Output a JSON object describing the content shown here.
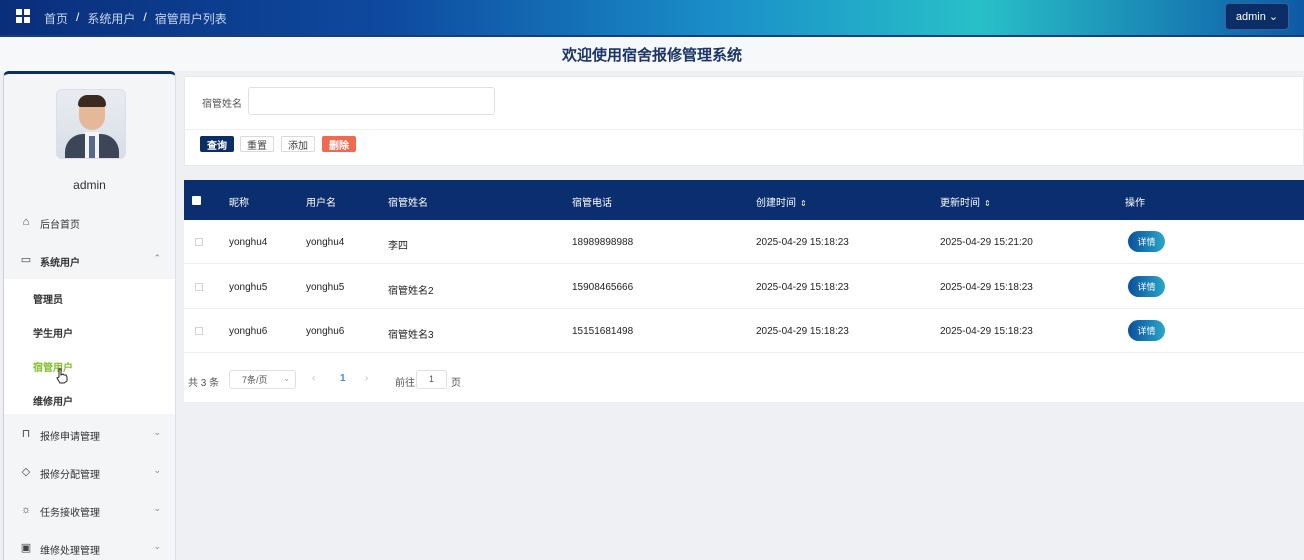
{
  "header": {
    "breadcrumb": [
      "首页",
      "系统用户",
      "宿管用户列表"
    ],
    "admin_label": "admin"
  },
  "page_title": "欢迎使用宿舍报修管理系统",
  "sidebar": {
    "username": "admin",
    "items": [
      {
        "label": "后台首页",
        "icon": "home-icon"
      },
      {
        "label": "系统用户",
        "icon": "monitor-icon"
      },
      {
        "label": "报修申请管理",
        "icon": "bookmark-icon"
      },
      {
        "label": "报修分配管理",
        "icon": "tag-icon"
      },
      {
        "label": "任务接收管理",
        "icon": "sun-icon"
      },
      {
        "label": "维修处理管理",
        "icon": "inbox-icon"
      }
    ],
    "sub_items": [
      {
        "label": "管理员",
        "active": false
      },
      {
        "label": "学生用户",
        "active": false
      },
      {
        "label": "宿管用户",
        "active": true
      },
      {
        "label": "维修用户",
        "active": false
      }
    ]
  },
  "search": {
    "label": "宿管姓名",
    "value": "",
    "buttons": {
      "query": "查询",
      "reset": "重置",
      "add": "添加",
      "delete": "删除"
    }
  },
  "table": {
    "columns": [
      "昵称",
      "用户名",
      "宿管姓名",
      "宿管电话",
      "创建时间",
      "更新时间",
      "操作"
    ],
    "rows": [
      {
        "nickname": "yonghu4",
        "username": "yonghu4",
        "name": "李四",
        "phone": "18989898988",
        "created": "2025-04-29 15:18:23",
        "updated": "2025-04-29 15:21:20",
        "action": "详情"
      },
      {
        "nickname": "yonghu5",
        "username": "yonghu5",
        "name": "宿管姓名2",
        "phone": "15908465666",
        "created": "2025-04-29 15:18:23",
        "updated": "2025-04-29 15:18:23",
        "action": "详情"
      },
      {
        "nickname": "yonghu6",
        "username": "yonghu6",
        "name": "宿管姓名3",
        "phone": "15151681498",
        "created": "2025-04-29 15:18:23",
        "updated": "2025-04-29 15:18:23",
        "action": "详情"
      }
    ]
  },
  "pagination": {
    "total": "共 3 条",
    "page_size": "7条/页",
    "current_page": "1",
    "goto_label": "前往",
    "goto_value": "1",
    "page_unit": "页"
  },
  "colors": {
    "primary": "#0b2e66",
    "danger": "#f06a50",
    "active_menu": "#7fc02a",
    "link": "#3b8ee0"
  }
}
